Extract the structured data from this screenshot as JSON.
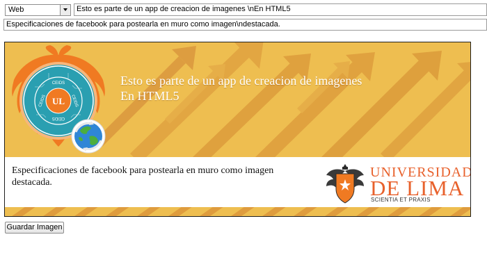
{
  "controls": {
    "platform_selected": "Web",
    "title_value": "Esto es parte de un app de creacion de imagenes \\nEn HTML5",
    "description_value": "Especificaciones de facebook para postearla en muro como imagen\\ndestacada.",
    "save_label": "Guardar Imagen"
  },
  "preview": {
    "title_text": "Esto es parte de un app de creacion de imagenes\nEn HTML5",
    "description_text": "Especificaciones de facebook para postearla en muro como imagen destacada.",
    "ceids_logo": {
      "center_letters": "UL",
      "ring_text": [
        "CEIDS",
        "CEIDS",
        "CEIDS",
        "CEIDS"
      ]
    },
    "university_logo": {
      "line1": "UNIVERSIDAD",
      "line2": "DE LIMA",
      "motto": "SCIENTIA ET PRAXIS"
    },
    "colors": {
      "background": "#eebe50",
      "arrow": "#df9b3d",
      "logo_orange": "#f07a22",
      "logo_teal": "#2a9fb1",
      "university_orange": "#e8612c"
    }
  }
}
